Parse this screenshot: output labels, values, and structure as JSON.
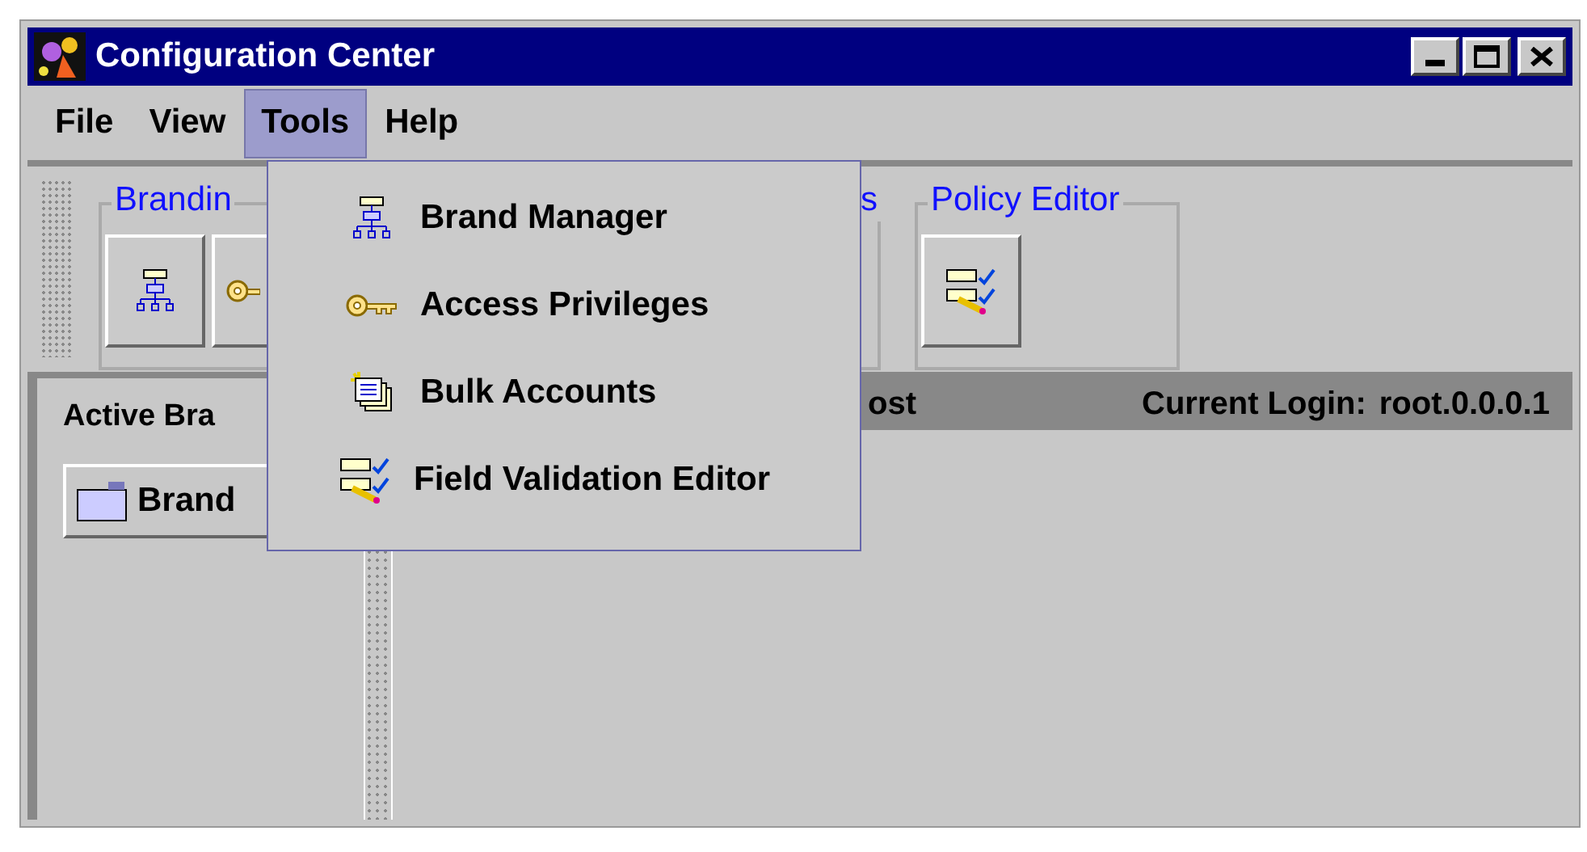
{
  "window": {
    "title": "Configuration Center"
  },
  "menu_bar": [
    {
      "label": "File",
      "selected": false
    },
    {
      "label": "View",
      "selected": false
    },
    {
      "label": "Tools",
      "selected": true
    },
    {
      "label": "Help",
      "selected": false
    }
  ],
  "toolbar_groups": [
    {
      "title": "Brandin"
    },
    {
      "title": "s"
    },
    {
      "title": "Policy Editor"
    }
  ],
  "left_panel": {
    "heading": "Active Bra",
    "button": "Brand"
  },
  "header_bar": {
    "column_1": "ost",
    "login_label": "Current Login:",
    "login_value": "root.0.0.0.1"
  },
  "tools_menu": [
    {
      "label": "Brand Manager",
      "kind": "hierarchy"
    },
    {
      "label": "Access Privileges",
      "kind": "key"
    },
    {
      "label": "Bulk Accounts",
      "kind": "stack"
    },
    {
      "label": "Field Validation Editor",
      "kind": "form"
    }
  ]
}
